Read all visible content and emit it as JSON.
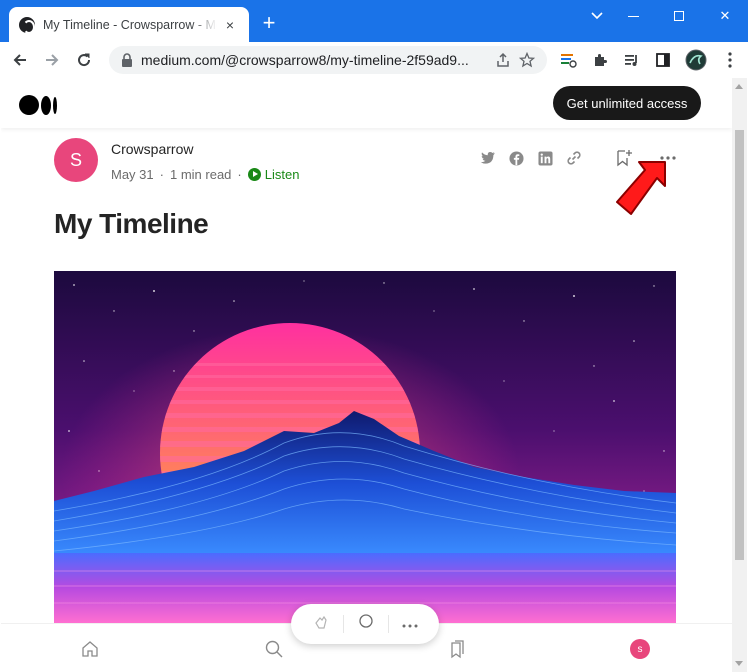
{
  "browser": {
    "tab_title": "My Timeline - Crowsparrow - Medium",
    "tab_close": "×",
    "new_tab": "+",
    "url": "medium.com/@crowsparrow8/my-timeline-2f59ad9...",
    "close_glyph": "✕"
  },
  "header": {
    "cta_label": "Get unlimited access"
  },
  "post": {
    "author_initial": "S",
    "author_name": "Crowsparrow",
    "date": "May 31",
    "read_time": "1 min read",
    "dot": "·",
    "listen_label": "Listen",
    "title": "My Timeline"
  },
  "bottom_nav": {
    "avatar_initial": "s"
  },
  "colors": {
    "tabstrip": "#1a73e8",
    "avatar": "#e8467c",
    "listen": "#1a8917",
    "cta": "#191919",
    "arrow": "#ff1a1a"
  }
}
